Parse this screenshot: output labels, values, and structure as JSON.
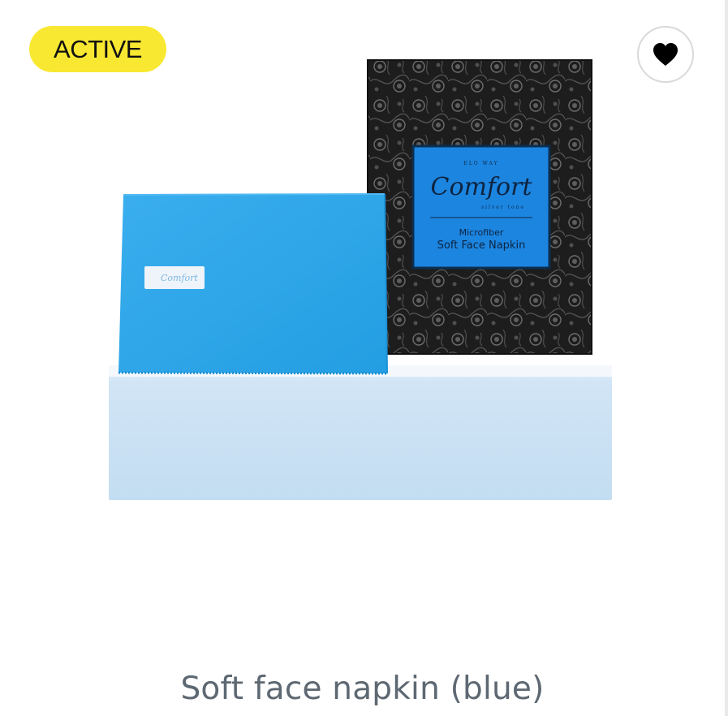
{
  "product": {
    "status_badge": "ACTIVE",
    "title": "Soft face napkin (blue)",
    "favorite_icon": "heart-icon",
    "image_text": {
      "brand_small": "ELO WAY",
      "brand": "Comfort",
      "brand_sub": "silver tone",
      "line1": "Microfiber",
      "line2": "Soft Face Napkin"
    }
  },
  "colors": {
    "badge_bg": "#f8e831",
    "napkin_blue": "#2fa6e8",
    "label_blue": "#1c85e0",
    "title_text": "#5d6872"
  }
}
